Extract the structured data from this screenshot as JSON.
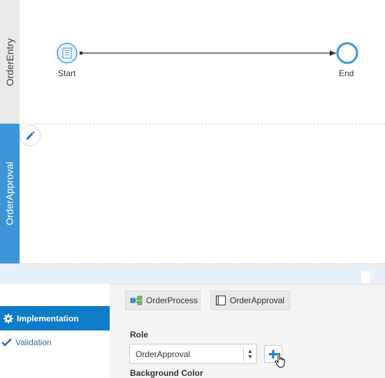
{
  "lanes": [
    {
      "label": "OrderEntry"
    },
    {
      "label": "OrderApproval"
    }
  ],
  "flow": {
    "start_label": "Start",
    "end_label": "End"
  },
  "panel": {
    "tabs": {
      "implementation": "Implementation",
      "validation": "Validation"
    },
    "chips": {
      "process": "OrderProcess",
      "role": "OrderApproval"
    },
    "role_label": "Role",
    "role_value": "OrderApproval",
    "background_color_label": "Background Color"
  },
  "colors": {
    "accent": "#0f7cc7",
    "lane_selected": "#3d95d5",
    "node_stroke": "#3d95d5"
  }
}
